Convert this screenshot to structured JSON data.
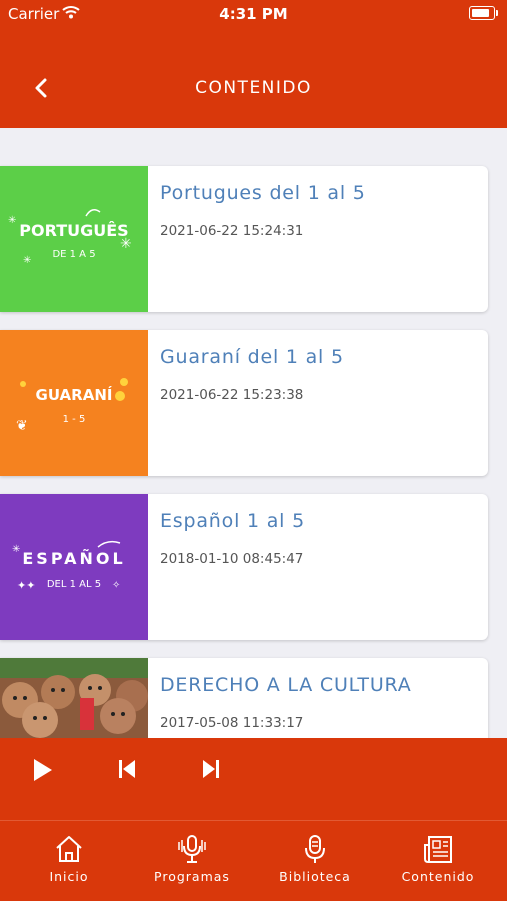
{
  "status_bar": {
    "carrier": "Carrier",
    "time": "4:31 PM",
    "wifi_icon": "wifi-icon",
    "battery_icon": "battery-icon"
  },
  "header": {
    "title": "CONTENIDO",
    "back_icon": "chevron-left-icon"
  },
  "items": [
    {
      "title": "Portugues del 1 al 5",
      "date": "2021-06-22 15:24:31",
      "thumb_color": "#5ccf48",
      "thumb_word": "PORTUGUÊS",
      "thumb_sub": "DE 1 A 5"
    },
    {
      "title": "Guaraní del 1 al 5",
      "date": "2021-06-22 15:23:38",
      "thumb_color": "#f5821f",
      "thumb_word": "GUARANÍ",
      "thumb_sub": "1 - 5"
    },
    {
      "title": "Español 1 al 5",
      "date": "2018-01-10 08:45:47",
      "thumb_color": "#7e3bbf",
      "thumb_word": "ESPAÑOL",
      "thumb_sub": "DEL 1 AL 5"
    },
    {
      "title": "DERECHO A LA CULTURA",
      "date": "2017-05-08 11:33:17",
      "thumb_color": "#a86f4f"
    }
  ],
  "player": {
    "play_icon": "play-icon",
    "previous_icon": "skip-previous-icon",
    "next_icon": "skip-next-icon"
  },
  "tabs": [
    {
      "label": "Inicio",
      "icon": "home-icon"
    },
    {
      "label": "Programas",
      "icon": "podcast-icon"
    },
    {
      "label": "Biblioteca",
      "icon": "microphone-icon"
    },
    {
      "label": "Contenido",
      "icon": "newspaper-icon"
    }
  ],
  "colors": {
    "brand": "#d9380b",
    "title_blue": "#4f80b8",
    "background": "#efeff4"
  }
}
